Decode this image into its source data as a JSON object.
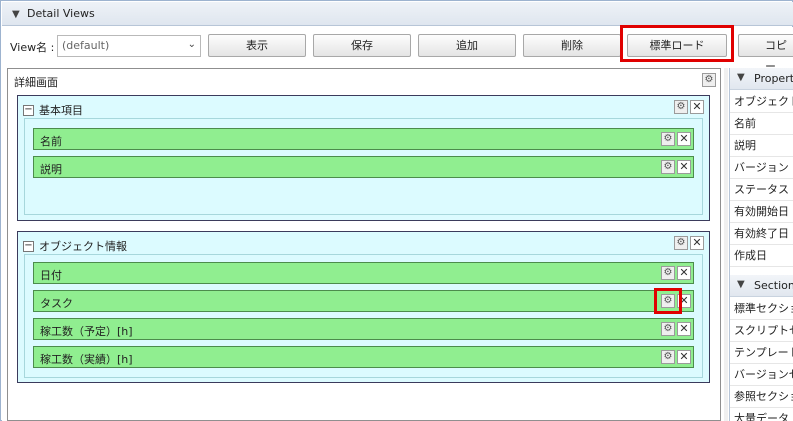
{
  "window": {
    "title": "Detail Views"
  },
  "toolbar": {
    "view_label": "View名 :",
    "view_select_value": "(default)",
    "buttons": {
      "show": "表示",
      "save": "保存",
      "add": "追加",
      "delete": "削除",
      "standard_load": "標準ロード",
      "copy": "コピー"
    }
  },
  "detail": {
    "title": "詳細画面",
    "sections": [
      {
        "title": "基本項目",
        "fields": [
          "名前",
          "説明"
        ]
      },
      {
        "title": "オブジェクト情報",
        "fields": [
          "日付",
          "タスク",
          "稼工数（予定）[h]",
          "稼工数（実績）[h]"
        ]
      }
    ]
  },
  "property_panel": {
    "header": "Property",
    "items": [
      "オブジェクト",
      "名前",
      "説明",
      "バージョン",
      "ステータス",
      "有効開始日",
      "有効終了日",
      "作成日"
    ]
  },
  "section_panel": {
    "header": "Section",
    "items": [
      "標準セクション",
      "スクリプトセクション",
      "テンプレート",
      "バージョンセクション",
      "参照セクション",
      "大量データ"
    ]
  },
  "icons": {
    "gear": "gear-icon",
    "close": "close-icon",
    "collapse": "minus-icon",
    "chevron": "chevron-down-icon"
  },
  "colors": {
    "highlight": "#e00000",
    "field_bg": "#90ee90",
    "section_bg": "#dcfbff"
  }
}
